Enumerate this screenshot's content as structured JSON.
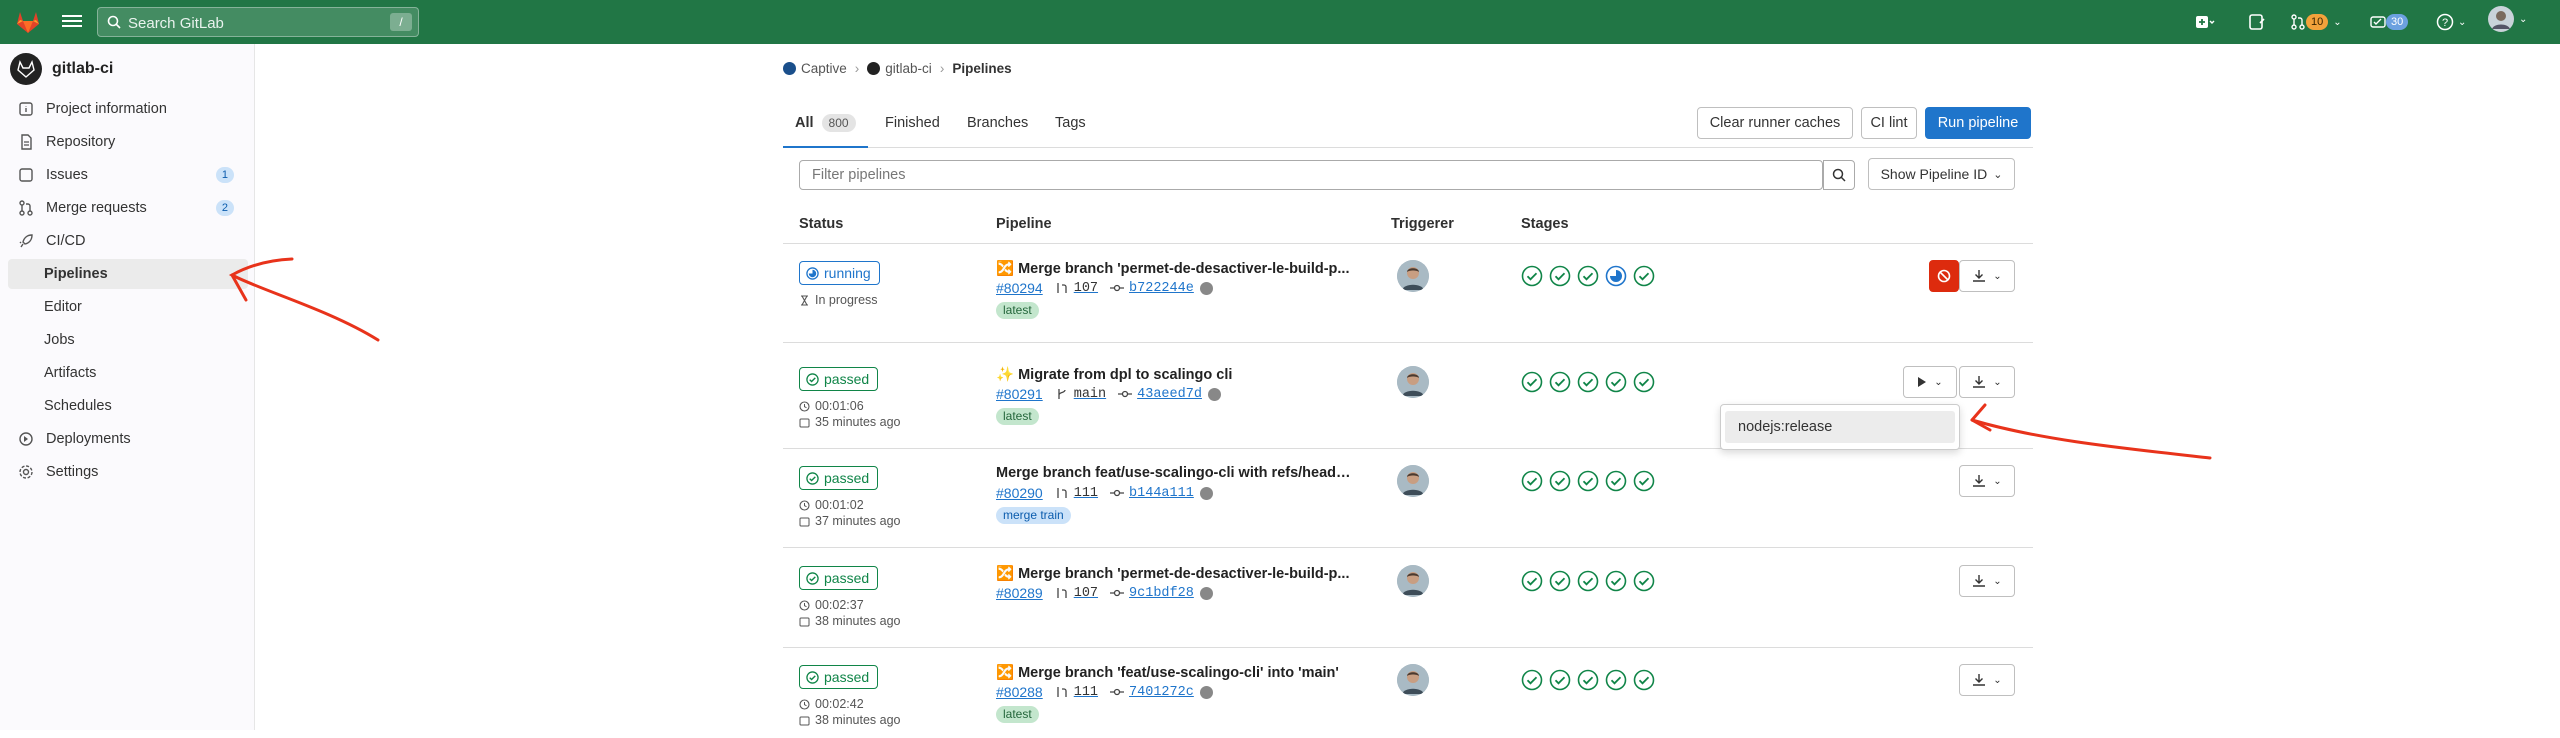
{
  "topbar": {
    "search_placeholder": "Search GitLab",
    "search_shortcut": "/",
    "merge_requests_count": "10",
    "todos_count": "30"
  },
  "sidebar": {
    "project_name": "gitlab-ci",
    "items": [
      {
        "label": "Project information",
        "icon": "info-icon"
      },
      {
        "label": "Repository",
        "icon": "doc-icon"
      },
      {
        "label": "Issues",
        "icon": "issues-icon",
        "count": "1"
      },
      {
        "label": "Merge requests",
        "icon": "merge-request-icon",
        "count": "2"
      },
      {
        "label": "CI/CD",
        "icon": "rocket-icon"
      },
      {
        "label": "Pipelines",
        "active": true
      },
      {
        "label": "Editor"
      },
      {
        "label": "Jobs"
      },
      {
        "label": "Artifacts"
      },
      {
        "label": "Schedules"
      },
      {
        "label": "Deployments",
        "icon": "deployments-icon"
      },
      {
        "label": "Settings",
        "icon": "gear-icon"
      }
    ]
  },
  "breadcrumb": {
    "group": "Captive",
    "project": "gitlab-ci",
    "current": "Pipelines"
  },
  "tabs": [
    {
      "label": "All",
      "count": "800"
    },
    {
      "label": "Finished"
    },
    {
      "label": "Branches"
    },
    {
      "label": "Tags"
    }
  ],
  "buttons": {
    "clear_caches": "Clear runner caches",
    "ci_lint": "CI lint",
    "run_pipeline": "Run pipeline",
    "show_pipeline_id": "Show Pipeline ID"
  },
  "filter_placeholder": "Filter pipelines",
  "columns": {
    "status": "Status",
    "pipeline": "Pipeline",
    "triggerer": "Triggerer",
    "stages": "Stages"
  },
  "pipelines": [
    {
      "status": "running",
      "meta1": "In progress",
      "meta2": "",
      "emoji": "🔀",
      "title": "Merge branch 'permet-de-desactiver-le-build-p...",
      "id": "#80294",
      "ref_kind": "mr",
      "ref": "107",
      "sha": "b722244e",
      "tag": "latest",
      "stages": [
        "success",
        "success",
        "success",
        "running",
        "success"
      ]
    },
    {
      "status": "passed",
      "meta1": "00:01:06",
      "meta2": "35 minutes ago",
      "emoji": "✨",
      "title": "Migrate from dpl to scalingo cli",
      "id": "#80291",
      "ref_kind": "branch",
      "ref": "main",
      "sha": "43aeed7d",
      "tag": "latest",
      "stages": [
        "success",
        "success",
        "success",
        "success",
        "success"
      ]
    },
    {
      "status": "passed",
      "meta1": "00:01:02",
      "meta2": "37 minutes ago",
      "emoji": "",
      "title": "Merge branch feat/use-scalingo-cli with refs/heads/...",
      "id": "#80290",
      "ref_kind": "mr",
      "ref": "111",
      "sha": "b144a111",
      "tag": "merge train",
      "stages": [
        "success",
        "success",
        "success",
        "success",
        "success"
      ]
    },
    {
      "status": "passed",
      "meta1": "00:02:37",
      "meta2": "38 minutes ago",
      "emoji": "🔀",
      "title": "Merge branch 'permet-de-desactiver-le-build-p...",
      "id": "#80289",
      "ref_kind": "mr",
      "ref": "107",
      "sha": "9c1bdf28",
      "tag": "",
      "stages": [
        "success",
        "success",
        "success",
        "success",
        "success"
      ]
    },
    {
      "status": "passed",
      "meta1": "00:02:42",
      "meta2": "38 minutes ago",
      "emoji": "🔀",
      "title": "Merge branch 'feat/use-scalingo-cli' into 'main'",
      "id": "#80288",
      "ref_kind": "mr",
      "ref": "111",
      "sha": "7401272c",
      "tag": "latest",
      "stages": [
        "success",
        "success",
        "success",
        "success",
        "success"
      ]
    }
  ],
  "manual_dropdown": {
    "item": "nodejs:release"
  },
  "colors": {
    "topbar": "#217645",
    "success": "#108548",
    "running": "#1f75cb",
    "primary": "#1f75cb",
    "danger": "#dd2b0e",
    "annotation": "#e8331b"
  }
}
